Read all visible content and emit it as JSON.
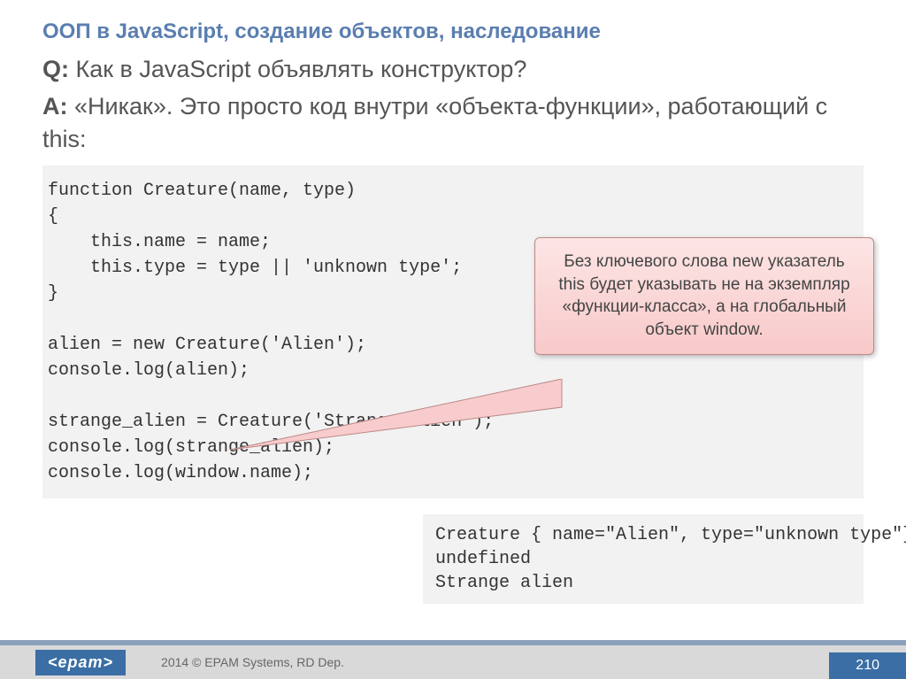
{
  "title": "ООП в JavaScript, создание объектов, наследование",
  "qa": {
    "q_label": "Q:",
    "q_text": " Как в JavaScript объявлять конструктор?",
    "a_label": "A:",
    "a_text": " «Никак». Это просто код внутри «объекта-функции», работающий с this:"
  },
  "code": "function Creature(name, type)\n{\n    this.name = name;\n    this.type = type || 'unknown type';\n}\n\nalien = new Creature('Alien');\nconsole.log(alien);\n\nstrange_alien = Creature('Strange alien');\nconsole.log(strange_alien);\nconsole.log(window.name);",
  "callout": "Без ключевого слова new указатель this будет указывать не на экземпляр «функции-класса», а на глобальный объект window.",
  "output": "Creature { name=\"Alien\", type=\"unknown type\"}\nundefined\nStrange alien",
  "footer": {
    "logo": "<epam>",
    "copyright": "2014 © EPAM Systems, RD Dep.",
    "page": "210"
  }
}
